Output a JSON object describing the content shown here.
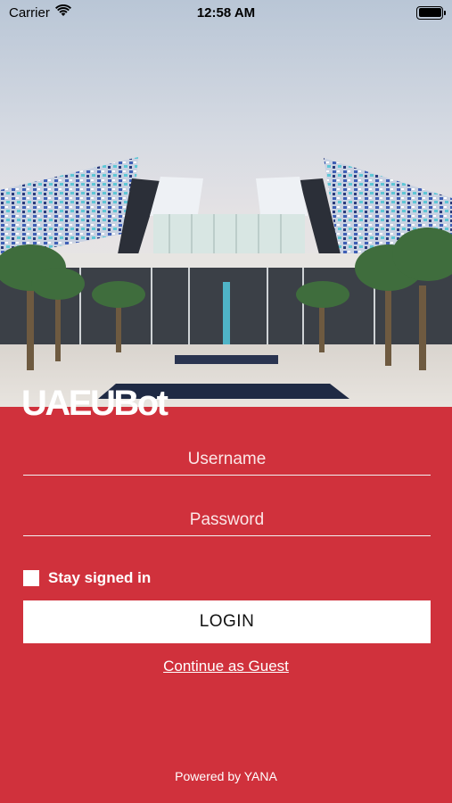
{
  "status_bar": {
    "carrier": "Carrier",
    "time": "12:58 AM"
  },
  "app": {
    "logo_text": "UAEUBot"
  },
  "login_form": {
    "username_placeholder": "Username",
    "password_placeholder": "Password",
    "stay_signed_in_label": "Stay signed in",
    "stay_signed_in_checked": false,
    "login_label": "LOGIN",
    "guest_label": "Continue as Guest"
  },
  "footer": {
    "powered_by": "Powered by YANA"
  },
  "colors": {
    "brand_red": "#d0313c",
    "button_bg": "#ffffff"
  }
}
